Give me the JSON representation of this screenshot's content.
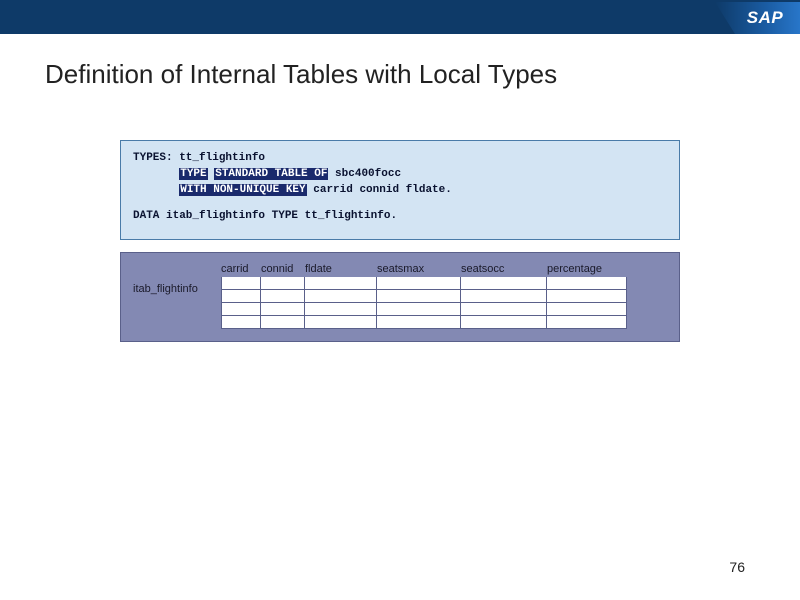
{
  "brand": "SAP",
  "title": "Definition of Internal Tables with Local Types",
  "code": {
    "l1a": "TYPES: tt_flightinfo",
    "l2a": "       ",
    "l2hl1": "TYPE",
    "l2b": " ",
    "l2hl2": "STANDARD TABLE OF",
    "l2c": " sbc400focc",
    "l3a": "       ",
    "l3hl1": "WITH NON-UNIQUE KEY",
    "l3b": " carrid connid fldate.",
    "l4": "DATA itab_flightinfo TYPE tt_flightinfo."
  },
  "table": {
    "row_label": "itab_flightinfo",
    "columns": {
      "carrid": "carrid",
      "connid": "connid",
      "fldate": "fldate",
      "seatsmax": "seatsmax",
      "seatsocc": "seatsocc",
      "percentage": "percentage"
    }
  },
  "page_number": "76"
}
